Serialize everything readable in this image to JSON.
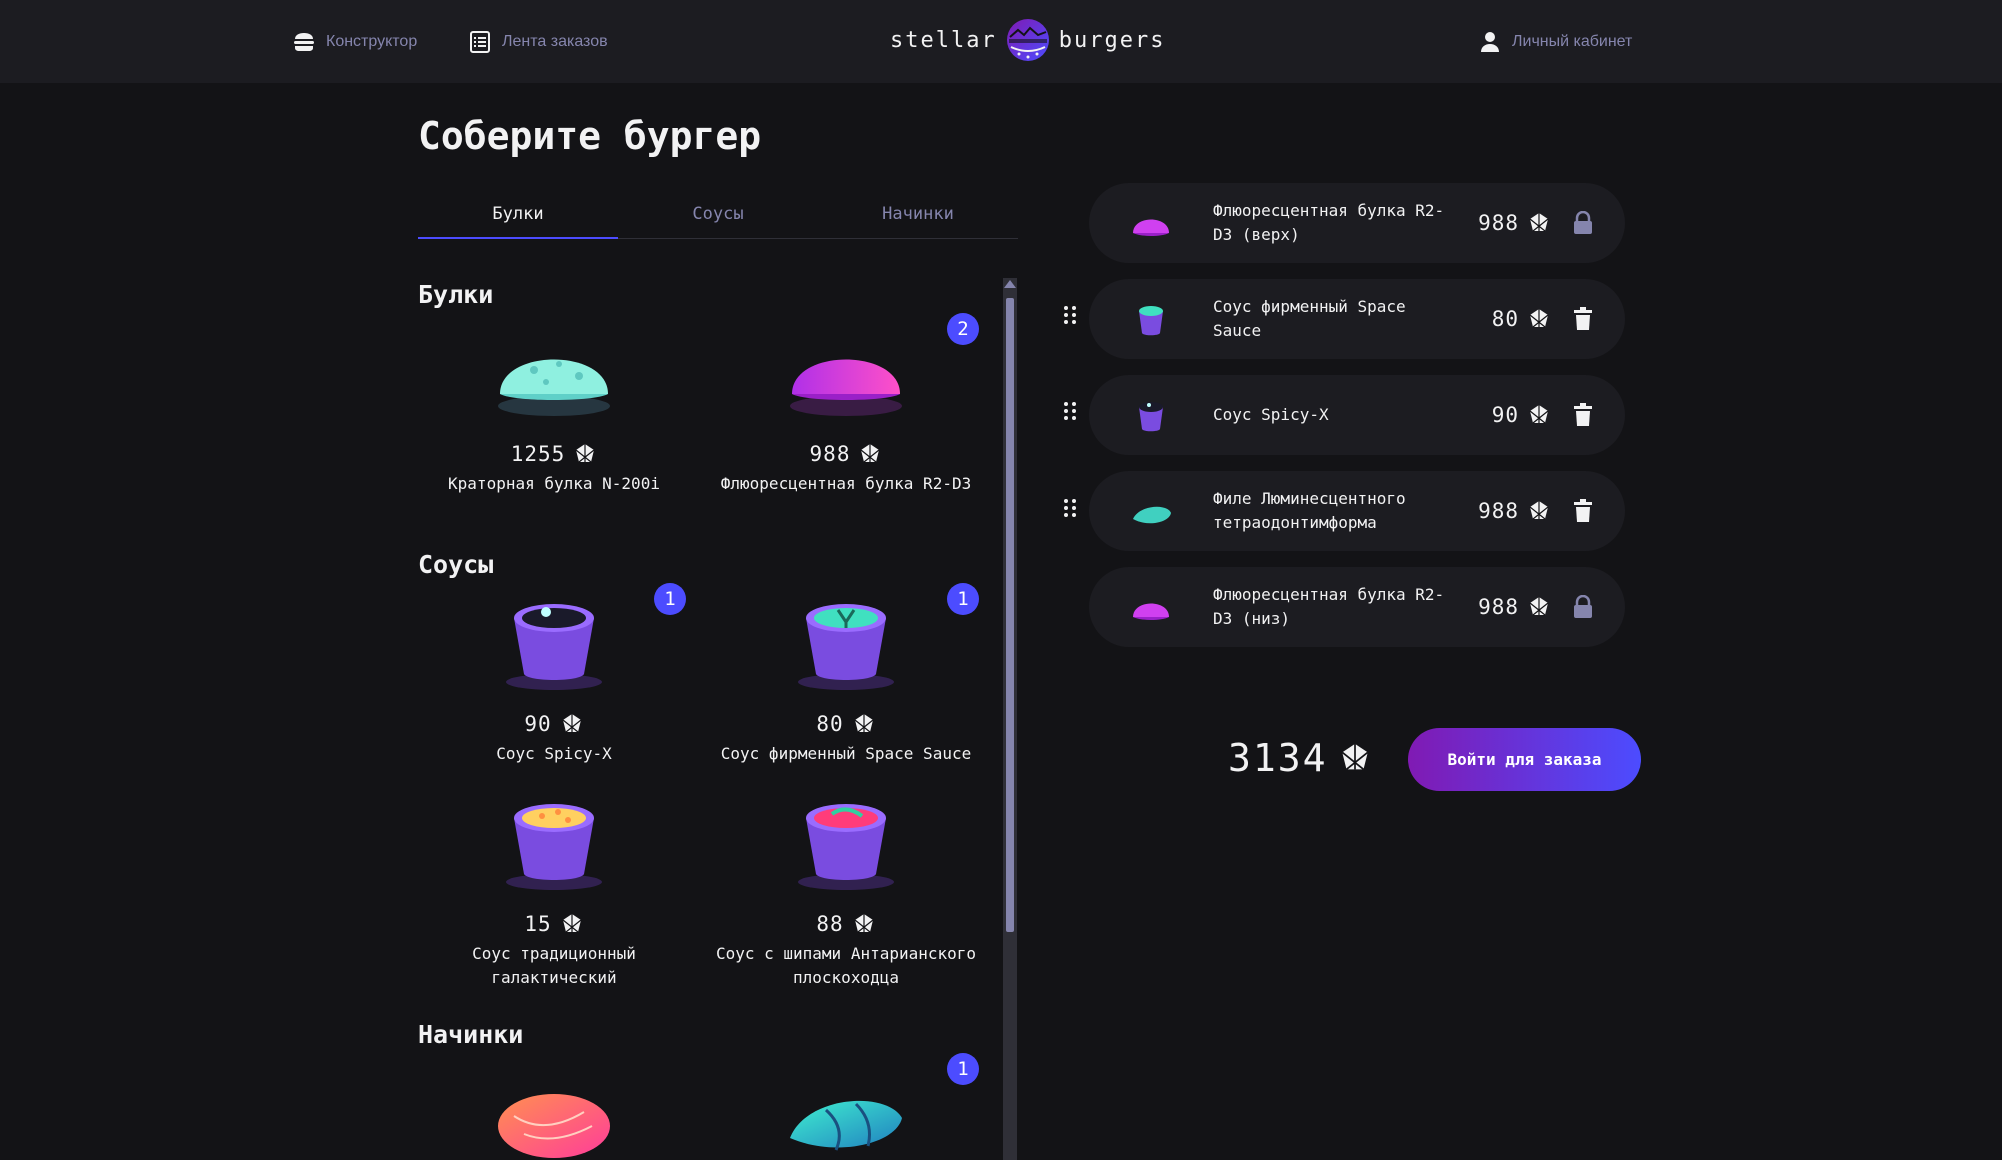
{
  "header": {
    "constructor_label": "Конструктор",
    "feed_label": "Лента заказов",
    "logo_left": "stellar",
    "logo_right": "burgers",
    "account_label": "Личный кабинет"
  },
  "main": {
    "title": "Соберите бургер",
    "tabs": [
      {
        "label": "Булки",
        "active": true
      },
      {
        "label": "Соусы",
        "active": false
      },
      {
        "label": "Начинки",
        "active": false
      }
    ]
  },
  "sections": {
    "buns": {
      "title": "Булки",
      "items": [
        {
          "name": "Краторная булка N-200i",
          "price": "1255",
          "count": null,
          "icon": "crater-bun"
        },
        {
          "name": "Флюоресцентная булка R2-D3",
          "price": "988",
          "count": "2",
          "icon": "fluorescent-bun"
        }
      ]
    },
    "sauces": {
      "title": "Соусы",
      "items": [
        {
          "name": "Соус Spicy-X",
          "price": "90",
          "count": "1",
          "icon": "sauce-spicy"
        },
        {
          "name": "Соус фирменный Space Sauce",
          "price": "80",
          "count": "1",
          "icon": "sauce-space"
        },
        {
          "name": "Соус традиционный галактический",
          "price": "15",
          "count": null,
          "icon": "sauce-traditional"
        },
        {
          "name": "Соус с шипами Антарианского плоскоходца",
          "price": "88",
          "count": null,
          "icon": "sauce-spiky"
        }
      ]
    },
    "fillings": {
      "title": "Начинки",
      "items": [
        {
          "count": null,
          "icon": "filling-salmon"
        },
        {
          "count": "1",
          "icon": "filling-fish"
        }
      ]
    }
  },
  "constructor": {
    "top": {
      "name": "Флюоресцентная булка R2-D3 (верх)",
      "price": "988",
      "icon": "lock-icon"
    },
    "fillings": [
      {
        "name": "Соус фирменный Space Sauce",
        "price": "80",
        "icon": "trash-icon"
      },
      {
        "name": "Соус Spicy-X",
        "price": "90",
        "icon": "trash-icon"
      },
      {
        "name": "Филе Люминесцентного тетраодонтимформа",
        "price": "988",
        "icon": "trash-icon"
      }
    ],
    "bottom": {
      "name": "Флюоресцентная булка R2-D3 (низ)",
      "price": "988",
      "icon": "lock-icon"
    },
    "total": "3134",
    "order_button": "Войти для заказа"
  },
  "colors": {
    "accent": "#4c4cff",
    "background": "#131316",
    "panel": "#1c1c21",
    "inactive": "#8585ad",
    "button_gradient_start": "#801ab3"
  }
}
